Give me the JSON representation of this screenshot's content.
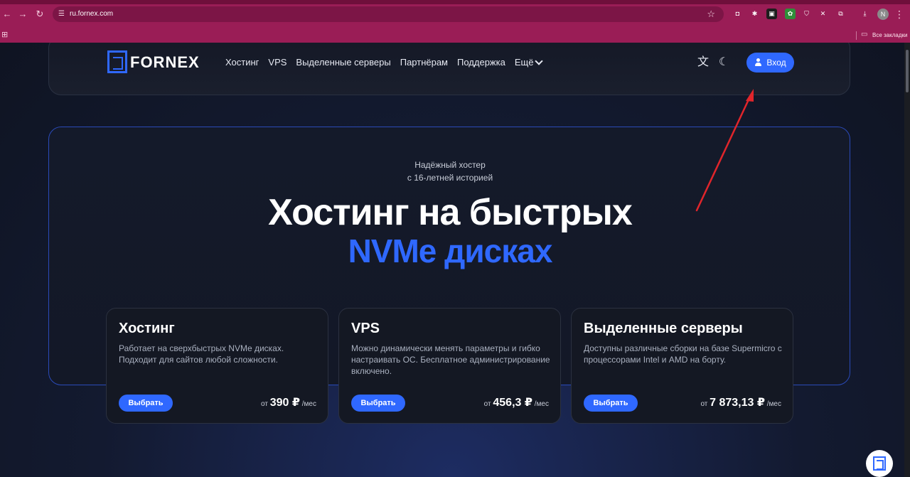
{
  "browser": {
    "url": "ru.fornex.com",
    "profile_initial": "N",
    "bookmarks_all_label": "Все закладки"
  },
  "header": {
    "logo_text": "FORNEX",
    "nav": [
      "Хостинг",
      "VPS",
      "Выделенные серверы",
      "Партнёрам",
      "Поддержка",
      "Ещё"
    ],
    "login_label": "Вход"
  },
  "hero": {
    "subtitle_line1": "Надёжный хостер",
    "subtitle_line2": "с 16-летней историей",
    "title_line1": "Хостинг на быстрых",
    "title_line2": "NVMe дисках"
  },
  "cards": [
    {
      "title": "Хостинг",
      "desc": "Работает на сверхбыстрых NVMe дисках. Подходит для сайтов любой сложности.",
      "button": "Выбрать",
      "price_prefix": "от",
      "price": "390 ₽",
      "price_suffix": "/мес"
    },
    {
      "title": "VPS",
      "desc": "Можно динамически менять параметры и гибко настраивать ОС. Бесплатное администрирование включено.",
      "button": "Выбрать",
      "price_prefix": "от",
      "price": "456,3 ₽",
      "price_suffix": "/мес"
    },
    {
      "title": "Выделенные серверы",
      "desc": "Доступны различные сборки на базе Supermicro с процессорами Intel и AMD на борту.",
      "button": "Выбрать",
      "price_prefix": "от",
      "price": "7 873,13 ₽",
      "price_suffix": "/мес"
    }
  ],
  "colors": {
    "accent": "#2f68ff",
    "chrome": "#9a1d56",
    "annotation_arrow": "#e0252b"
  }
}
